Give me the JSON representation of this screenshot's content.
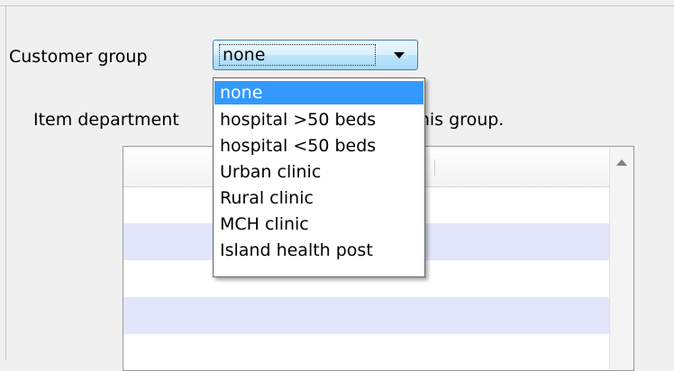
{
  "customer_group": {
    "label": "Customer group",
    "selected_value": "none",
    "options": [
      "none",
      "hospital >50 beds",
      "hospital <50 beds",
      "Urban clinic",
      "Rural clinic",
      "MCH clinic",
      "Island health post"
    ]
  },
  "item_department_text": "Item department                              plied to this group.",
  "list_header_partial": ":"
}
